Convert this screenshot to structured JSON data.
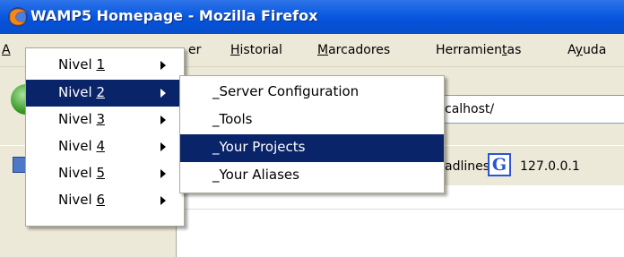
{
  "window": {
    "title": "WAMP5 Homepage - Mozilla Firefox"
  },
  "menubar": {
    "items": [
      {
        "accel": "A",
        "rest": "",
        "label": "A"
      },
      {
        "prefix": "",
        "accel": "",
        "rest": "er",
        "label": "er"
      },
      {
        "accel": "H",
        "rest": "istorial",
        "label": "Historial"
      },
      {
        "accel": "M",
        "rest": "arcadores",
        "label": "Marcadores"
      },
      {
        "pre": "Herramien",
        "accel": "t",
        "rest": "as",
        "label": "Herramientas"
      },
      {
        "pre": "A",
        "accel": "y",
        "rest": "uda",
        "label": "Ayuda"
      }
    ]
  },
  "navbar": {
    "url": "calhost/"
  },
  "bookmarks": {
    "headlines": "adlines",
    "google_icon_letter": "G",
    "localhost": "127.0.0.1"
  },
  "menu_level1": {
    "items": [
      {
        "text": "Nivel ",
        "accel": "1",
        "highlighted": false
      },
      {
        "text": "Nivel ",
        "accel": "2",
        "highlighted": true
      },
      {
        "text": "Nivel ",
        "accel": "3",
        "highlighted": false
      },
      {
        "text": "Nivel ",
        "accel": "4",
        "highlighted": false
      },
      {
        "text": "Nivel ",
        "accel": "5",
        "highlighted": false
      },
      {
        "text": "Nivel ",
        "accel": "6",
        "highlighted": false
      }
    ]
  },
  "menu_level2": {
    "items": [
      {
        "prefix": "_",
        "label": "Server Configuration",
        "display": "_Server Configuration",
        "highlighted": false
      },
      {
        "prefix": "_",
        "label": "Tools",
        "display": "_Tools",
        "highlighted": false
      },
      {
        "prefix": "_",
        "label": "Your Projects",
        "display": "_Your Projects",
        "highlighted": true
      },
      {
        "prefix": "_",
        "label": "Your Aliases",
        "display": "_Your Aliases",
        "highlighted": false
      }
    ]
  },
  "icons": {
    "app": "firefox-icon",
    "back": "back-globe-icon",
    "bookmark": "bookmark-icon",
    "google": "google-icon",
    "submenu": "chevron-right-icon"
  },
  "colors": {
    "titlebar": "#0a5ae0",
    "highlight": "#0a246a",
    "menu_bg": "#ffffff"
  }
}
